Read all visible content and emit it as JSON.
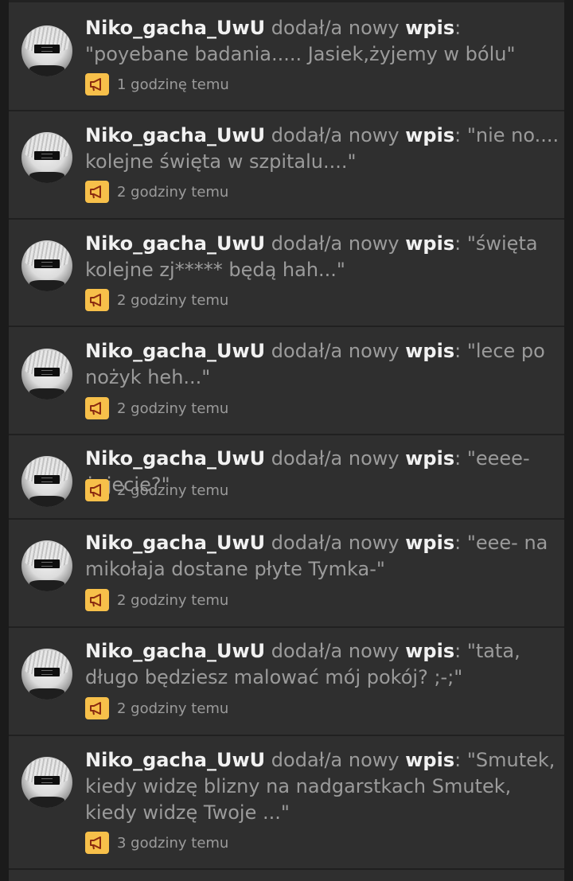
{
  "colors": {
    "background": "#2f2f2f",
    "text_primary": "#f1f1f1",
    "text_secondary": "#9b9b9b",
    "badge": "#f7c04a"
  },
  "action_text": " dodał/a nowy ",
  "entries": [
    {
      "user": "Niko_gacha_UwU",
      "kind": "wpis",
      "content": ": \"poyebane badania..... Jasiek,żyjemy w bólu\"",
      "time": "1 godzinę temu",
      "icon": "megaphone-icon"
    },
    {
      "user": "Niko_gacha_UwU",
      "kind": "wpis",
      "content": ": \"nie no.... kolejne święta w szpitalu....\"",
      "time": "2 godziny temu",
      "icon": "megaphone-icon"
    },
    {
      "user": "Niko_gacha_UwU",
      "kind": "wpis",
      "content": ": \"święta kolejne zj***** będą hah...\"",
      "time": "2 godziny temu",
      "icon": "megaphone-icon"
    },
    {
      "user": "Niko_gacha_UwU",
      "kind": "wpis",
      "content": ": \"lece po nożyk heh...\"",
      "time": "2 godziny temu",
      "icon": "megaphone-icon"
    },
    {
      "user": "Niko_gacha_UwU",
      "kind": "wpis",
      "content": ": \"eeee-żyjecie?\"",
      "time": "2 godziny temu",
      "icon": "megaphone-icon"
    },
    {
      "user": "Niko_gacha_UwU",
      "kind": "wpis",
      "content": ": \"eee- na mikołaja dostane płyte Tymka-\"",
      "time": "2 godziny temu",
      "icon": "megaphone-icon"
    },
    {
      "user": "Niko_gacha_UwU",
      "kind": "wpis",
      "content": ": \"tata, długo będziesz malować mój pokój? ;-;\"",
      "time": "2 godziny temu",
      "icon": "megaphone-icon"
    },
    {
      "user": "Niko_gacha_UwU",
      "kind": "wpis",
      "content": ": \"Smutek, kiedy widzę blizny na nadgarstkach Smutek, kiedy widzę Twoje ...\"",
      "time": "3 godziny temu",
      "icon": "megaphone-icon"
    }
  ]
}
